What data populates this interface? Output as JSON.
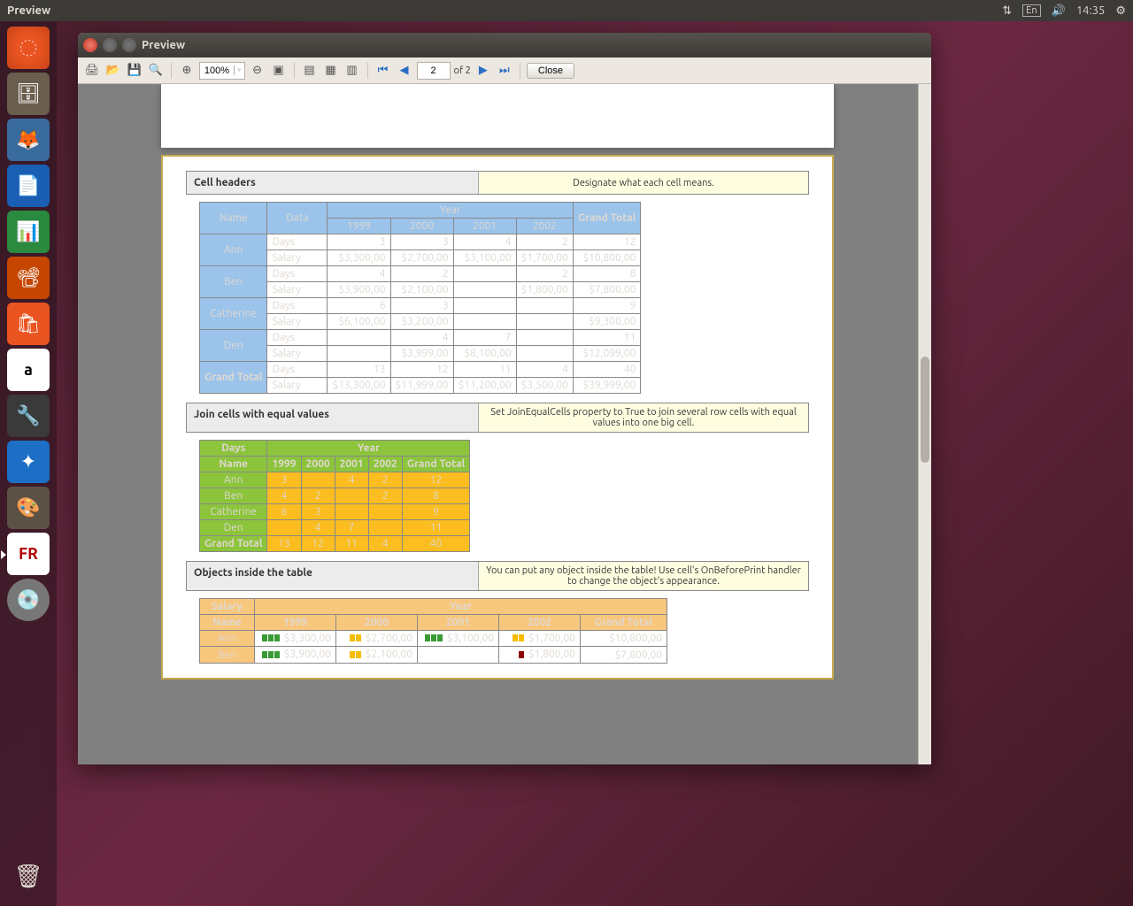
{
  "menubar": {
    "title": "Preview",
    "lang": "En",
    "time": "14:35"
  },
  "window": {
    "title": "Preview"
  },
  "toolbar": {
    "zoom": "100%",
    "page": "2",
    "page_of": "of 2",
    "close": "Close"
  },
  "sections": {
    "s1": {
      "title": "Cell headers",
      "desc": "Designate what each cell means."
    },
    "s2": {
      "title": "Join cells with equal values",
      "desc": "Set JoinEqualCells property to True to join several row cells with equal values into one big cell."
    },
    "s3": {
      "title": "Objects inside the table",
      "desc": "You can put any object inside the table! Use cell's OnBeforePrint handler to change the object's appearance."
    }
  },
  "t1": {
    "corner_name": "Name",
    "corner_data": "Data",
    "year": "Year",
    "years": [
      "1999",
      "2000",
      "2001",
      "2002"
    ],
    "grand": "Grand Total",
    "rows": [
      {
        "name": "Ann",
        "data": [
          {
            "lbl": "Days",
            "v": [
              "3",
              "3",
              "4",
              "2"
            ],
            "g": "12"
          },
          {
            "lbl": "Salary",
            "v": [
              "$3,300,00",
              "$2,700,00",
              "$3,100,00",
              "$1,700,00"
            ],
            "g": "$10,800,00"
          }
        ]
      },
      {
        "name": "Ben",
        "data": [
          {
            "lbl": "Days",
            "v": [
              "4",
              "2",
              "",
              "2"
            ],
            "g": "8"
          },
          {
            "lbl": "Salary",
            "v": [
              "$3,900,00",
              "$2,100,00",
              "",
              "$1,800,00"
            ],
            "g": "$7,800,00"
          }
        ]
      },
      {
        "name": "Catherine",
        "data": [
          {
            "lbl": "Days",
            "v": [
              "6",
              "3",
              "",
              ""
            ],
            "g": "9"
          },
          {
            "lbl": "Salary",
            "v": [
              "$6,100,00",
              "$3,200,00",
              "",
              ""
            ],
            "g": "$9,300,00"
          }
        ]
      },
      {
        "name": "Den",
        "data": [
          {
            "lbl": "Days",
            "v": [
              "",
              "4",
              "7",
              ""
            ],
            "g": "11"
          },
          {
            "lbl": "Salary",
            "v": [
              "",
              "$3,999,00",
              "$8,100,00",
              ""
            ],
            "g": "$12,099,00"
          }
        ]
      }
    ],
    "total": {
      "name": "Grand Total",
      "data": [
        {
          "lbl": "Days",
          "v": [
            "13",
            "12",
            "11",
            "4"
          ],
          "g": "40"
        },
        {
          "lbl": "Salary",
          "v": [
            "$13,300,00",
            "$11,999,00",
            "$11,200,00",
            "$3,500,00"
          ],
          "g": "$39,999,00"
        }
      ]
    }
  },
  "t2": {
    "days": "Days",
    "year": "Year",
    "name": "Name",
    "years": [
      "1999",
      "2000",
      "2001",
      "2002"
    ],
    "grand": "Grand Total",
    "rows": [
      {
        "name": "Ann",
        "v": [
          "3",
          "",
          "4",
          "2"
        ],
        "g": "12"
      },
      {
        "name": "Ben",
        "v": [
          "4",
          "2",
          "",
          "2"
        ],
        "g": "8"
      },
      {
        "name": "Catherine",
        "v": [
          "6",
          "3",
          "",
          ""
        ],
        "g": "9"
      },
      {
        "name": "Den",
        "v": [
          "",
          "4",
          "7",
          ""
        ],
        "g": "11"
      }
    ],
    "total": {
      "name": "Grand Total",
      "v": [
        "13",
        "12",
        "11",
        "4"
      ],
      "g": "40"
    }
  },
  "t3": {
    "salary": "Salary",
    "year": "Year",
    "name": "Name",
    "years": [
      "1999",
      "2000",
      "2001",
      "2002"
    ],
    "grand": "Grand Total",
    "rows": [
      {
        "name": "Ann",
        "bars": [
          3,
          2,
          3,
          2
        ],
        "v": [
          "$3,300,00",
          "$2,700,00",
          "$3,100,00",
          "$1,700,00"
        ],
        "g": "$10,800,00"
      },
      {
        "name": "Ben",
        "bars": [
          3,
          2,
          0,
          1
        ],
        "v": [
          "$3,900,00",
          "$2,100,00",
          "",
          "$1,800,00"
        ],
        "g": "$7,800,00"
      }
    ]
  }
}
